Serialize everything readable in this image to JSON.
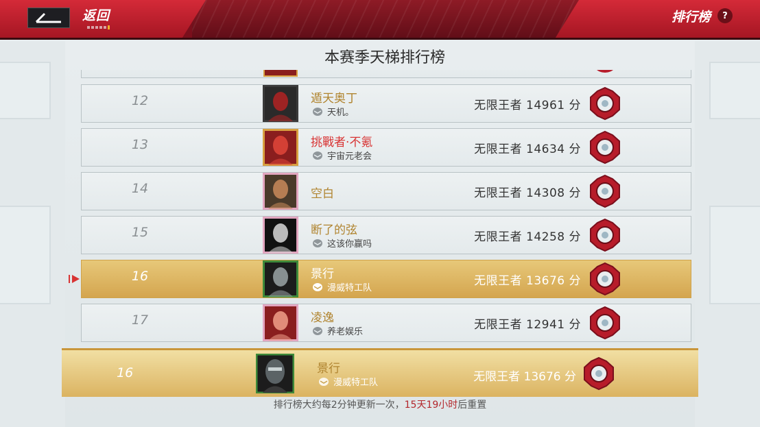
{
  "header": {
    "back_label": "返回",
    "title": "排行榜",
    "help_label": "?"
  },
  "panel": {
    "title": "本赛季天梯排行榜"
  },
  "rows": [
    {
      "rank": "12",
      "name": "遁天奥丁",
      "name_color": "gold",
      "guild": "天机。",
      "score": "无限王者 14961 分",
      "avatar_palette": "#2a2a2a",
      "avatar_accent": "#b22222",
      "frame": "dark",
      "highlight": false
    },
    {
      "rank": "13",
      "name": "挑戰者·不氪",
      "name_color": "red",
      "guild": "宇宙元老会",
      "score": "无限王者 14634 分",
      "avatar_palette": "#8a1e1e",
      "avatar_accent": "#e0463a",
      "frame": "gold",
      "highlight": false
    },
    {
      "rank": "14",
      "name": "空白",
      "name_color": "gold",
      "guild": "",
      "score": "无限王者 14308 分",
      "avatar_palette": "#4a3a2a",
      "avatar_accent": "#c98a5a",
      "frame": "pink",
      "highlight": false
    },
    {
      "rank": "15",
      "name": "断了的弦",
      "name_color": "gold",
      "guild": "这该你赢吗",
      "score": "无限王者 14258 分",
      "avatar_palette": "#111111",
      "avatar_accent": "#d9d9d9",
      "frame": "pink",
      "highlight": false
    },
    {
      "rank": "16",
      "name": "景行",
      "name_color": "white",
      "guild": "漫威特工队",
      "score": "无限王者 13676 分",
      "avatar_palette": "#1c1c1c",
      "avatar_accent": "#9aa3a6",
      "frame": "green",
      "highlight": true
    },
    {
      "rank": "17",
      "name": "凌逸",
      "name_color": "gold",
      "guild": "养老娱乐",
      "score": "无限王者 12941 分",
      "avatar_palette": "#8a1e1e",
      "avatar_accent": "#f0a08a",
      "frame": "pink",
      "highlight": false
    }
  ],
  "my_rank": {
    "rank": "16",
    "name": "景行",
    "guild": "漫威特工队",
    "score": "无限王者 13676 分"
  },
  "footer": {
    "prefix": "排行榜大约每2分钟更新一次，",
    "countdown": "15天19小时",
    "suffix": "后重置"
  },
  "colors": {
    "brand_red": "#c8202f",
    "gold": "#b0842f",
    "highlight": "#d4a54f"
  }
}
